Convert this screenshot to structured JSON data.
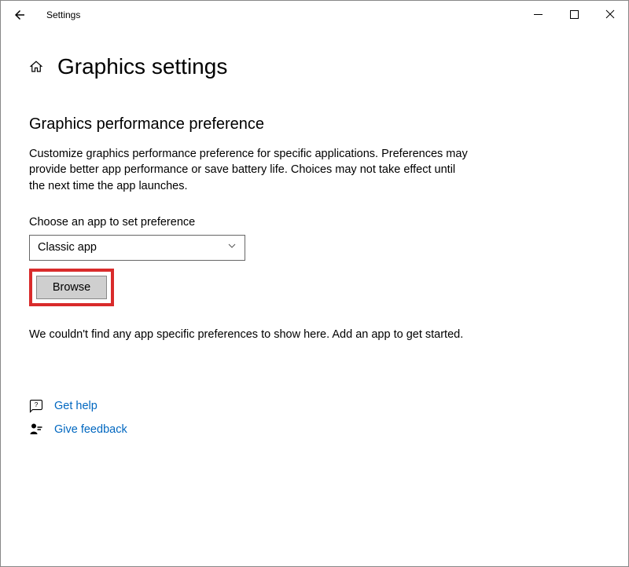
{
  "titlebar": {
    "title": "Settings"
  },
  "page": {
    "title": "Graphics settings",
    "section_title": "Graphics performance preference",
    "description": "Customize graphics performance preference for specific applications. Preferences may provide better app performance or save battery life. Choices may not take effect until the next time the app launches.",
    "field_label": "Choose an app to set preference",
    "dropdown_value": "Classic app",
    "browse_label": "Browse",
    "empty_message": "We couldn't find any app specific preferences to show here. Add an app to get started."
  },
  "links": {
    "get_help": "Get help",
    "give_feedback": "Give feedback"
  }
}
